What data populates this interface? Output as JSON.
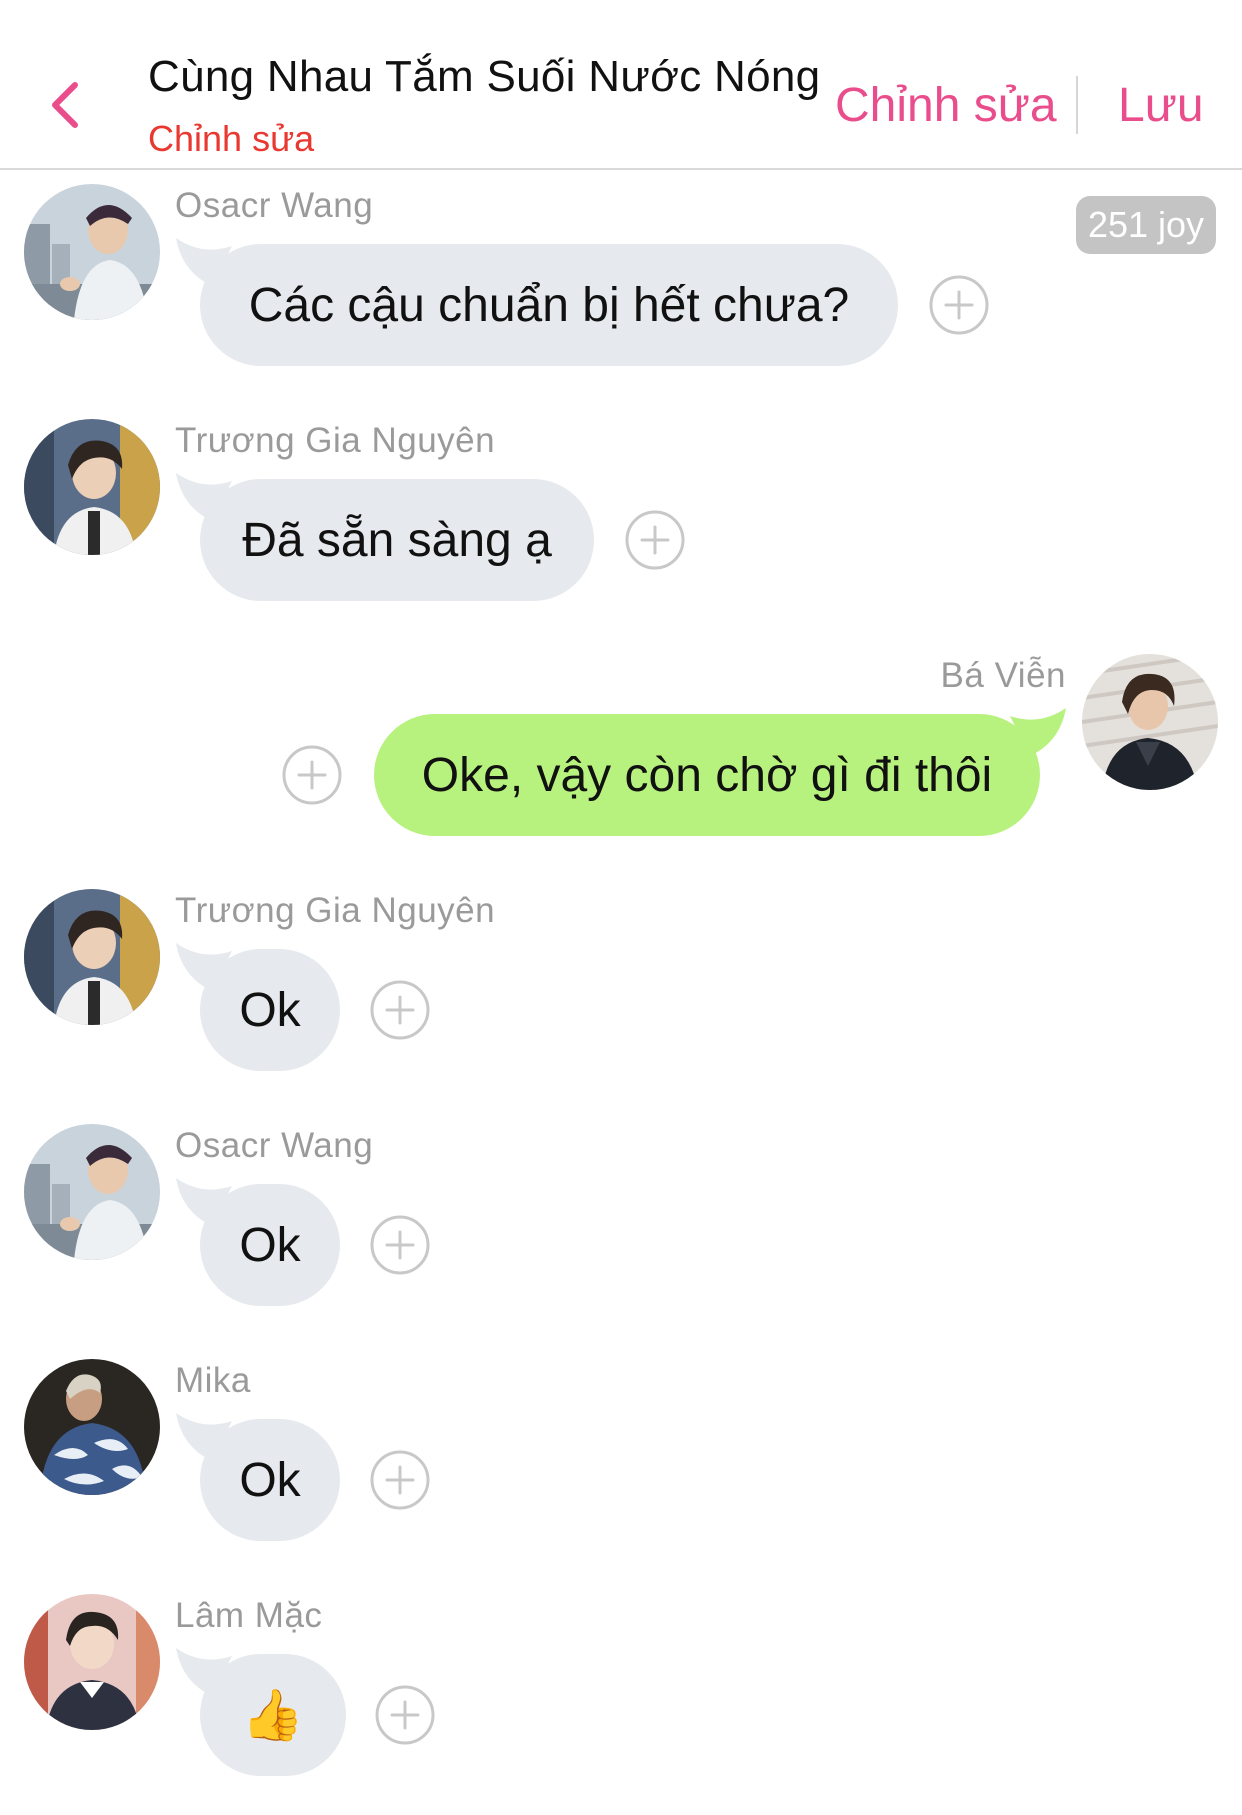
{
  "header": {
    "back_icon": "chevron-left-icon",
    "title": "Cùng Nhau Tắm Suối Nước Nóng",
    "subtitle": "Chỉnh sửa",
    "edit_label": "Chỉnh sửa",
    "save_label": "Lưu",
    "accent_color": "#ea4d8c",
    "subtitle_color": "#e8382f"
  },
  "badge": {
    "text": "251 joy"
  },
  "messages": [
    {
      "sender": "Osacr Wang",
      "text": "Các cậu chuẩn bị hết chưa?",
      "side": "left",
      "bubble_color": "#e6e9ed"
    },
    {
      "sender": "Trương Gia Nguyên",
      "text": "Đã sẵn sàng ạ",
      "side": "left",
      "bubble_color": "#e6e9ed"
    },
    {
      "sender": "Bá Viễn",
      "text": "Oke, vậy còn chờ gì đi thôi",
      "side": "right",
      "bubble_color": "#b8f27e"
    },
    {
      "sender": "Trương Gia Nguyên",
      "text": "Ok",
      "side": "left",
      "bubble_color": "#e6e9ed"
    },
    {
      "sender": "Osacr Wang",
      "text": "Ok",
      "side": "left",
      "bubble_color": "#e6e9ed"
    },
    {
      "sender": "Mika",
      "text": "Ok",
      "side": "left",
      "bubble_color": "#e6e9ed"
    },
    {
      "sender": "Lâm Mặc",
      "text": "👍",
      "side": "left",
      "bubble_color": "#e6e9ed",
      "icon": "thumbs-up-icon"
    }
  ]
}
